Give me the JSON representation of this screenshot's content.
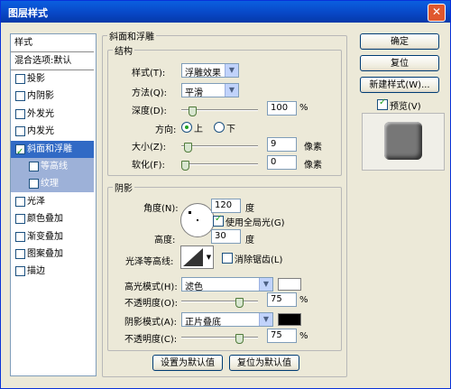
{
  "window": {
    "title": "图层样式",
    "close_icon": "close-icon"
  },
  "left_list": {
    "header": "样式",
    "blend_default": "混合选项:默认",
    "items": [
      {
        "label": "投影",
        "checked": false
      },
      {
        "label": "内阴影",
        "checked": false
      },
      {
        "label": "外发光",
        "checked": false
      },
      {
        "label": "内发光",
        "checked": false
      },
      {
        "label": "斜面和浮雕",
        "checked": true,
        "selected": true
      },
      {
        "label": "等高线",
        "checked": false,
        "sub": true
      },
      {
        "label": "纹理",
        "checked": false,
        "sub": true
      },
      {
        "label": "光泽",
        "checked": false
      },
      {
        "label": "颜色叠加",
        "checked": false
      },
      {
        "label": "渐变叠加",
        "checked": false
      },
      {
        "label": "图案叠加",
        "checked": false
      },
      {
        "label": "描边",
        "checked": false
      }
    ]
  },
  "bevel": {
    "title": "斜面和浮雕",
    "structure": {
      "title": "结构",
      "style_label": "样式(T):",
      "style_value": "浮雕效果",
      "technique_label": "方法(Q):",
      "technique_value": "平滑",
      "depth_label": "深度(D):",
      "depth_value": "100",
      "depth_unit": "%",
      "depth_fraction": 0.1,
      "direction_label": "方向:",
      "dir_up": "上",
      "dir_down": "下",
      "size_label": "大小(Z):",
      "size_value": "9",
      "size_unit": "像素",
      "size_fraction": 0.04,
      "soften_label": "软化(F):",
      "soften_value": "0",
      "soften_unit": "像素",
      "soften_fraction": 0.0
    },
    "shading": {
      "title": "阴影",
      "angle_label": "角度(N):",
      "angle_value": "120",
      "angle_unit": "度",
      "global_light": "使用全局光(G)",
      "altitude_label": "高度:",
      "altitude_value": "30",
      "altitude_unit": "度",
      "gloss_label": "光泽等高线:",
      "anti_alias": "消除锯齿(L)",
      "highlight_label": "高光模式(H):",
      "highlight_mode": "滤色",
      "highlight_color": "#ffffff",
      "highlight_opacity_label": "不透明度(O):",
      "highlight_opacity": "75",
      "highlight_opacity_fraction": 0.75,
      "shadow_label": "阴影模式(A):",
      "shadow_mode": "正片叠底",
      "shadow_color": "#000000",
      "shadow_opacity_label": "不透明度(C):",
      "shadow_opacity": "75",
      "shadow_opacity_fraction": 0.75,
      "opacity_unit": "%"
    },
    "make_default": "设置为默认值",
    "reset_default": "复位为默认值"
  },
  "right_buttons": {
    "ok": "确定",
    "reset": "复位",
    "new_style": "新建样式(W)...",
    "preview": "预览(V)"
  }
}
